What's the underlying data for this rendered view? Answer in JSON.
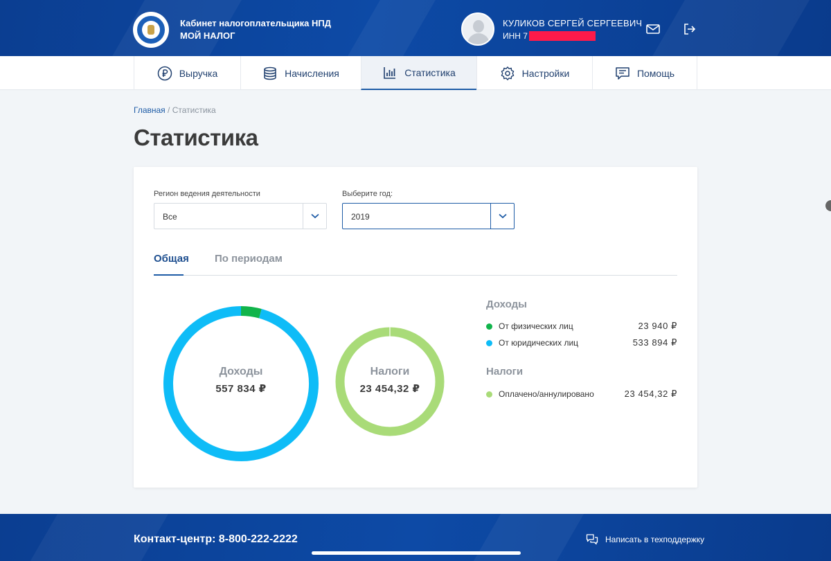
{
  "header": {
    "brand_line1": "Кабинет налогоплательщика НПД",
    "brand_line2": "МОЙ НАЛОГ",
    "user_name": "КУЛИКОВ СЕРГЕЙ СЕРГЕЕВИЧ",
    "inn_label": "ИНН 7"
  },
  "nav": [
    {
      "label": "Выручка",
      "icon": "ruble-icon"
    },
    {
      "label": "Начисления",
      "icon": "coins-icon"
    },
    {
      "label": "Статистика",
      "icon": "bar-chart-icon",
      "active": true
    },
    {
      "label": "Настройки",
      "icon": "gear-icon"
    },
    {
      "label": "Помощь",
      "icon": "help-chat-icon"
    }
  ],
  "breadcrumb": {
    "home": "Главная",
    "separator": " / ",
    "current": "Статистика"
  },
  "page_title": "Статистика",
  "filters": {
    "region_label": "Регион ведения деятельности",
    "region_value": "Все",
    "year_label": "Выберите год:",
    "year_value": "2019"
  },
  "tabs": {
    "general": "Общая",
    "periods": "По периодам"
  },
  "colors": {
    "physical": "#11b44b",
    "legal": "#0ebcf7",
    "taxes": "#a9db78",
    "brand": "#1d5ba6"
  },
  "income_donut": {
    "title": "Доходы",
    "value": "557 834 ₽"
  },
  "tax_donut": {
    "title": "Налоги",
    "value": "23 454,32 ₽"
  },
  "legend": {
    "income_heading": "Доходы",
    "physical_label": "От физических лиц",
    "physical_amount": "23 940 ₽",
    "legal_label": "От юридических лиц",
    "legal_amount": "533 894 ₽",
    "tax_heading": "Налоги",
    "paid_label": "Оплачено/аннулировано",
    "paid_amount": "23 454,32 ₽"
  },
  "chart_data": [
    {
      "type": "pie",
      "title": "Доходы",
      "categories": [
        "От физических лиц",
        "От юридических лиц"
      ],
      "values": [
        23940,
        533894
      ]
    },
    {
      "type": "pie",
      "title": "Налоги",
      "categories": [
        "Оплачено/аннулировано"
      ],
      "values": [
        23454.32
      ]
    }
  ],
  "footer": {
    "contact": "Контакт-центр: 8-800-222-2222",
    "support": "Написать в техподдержку"
  }
}
